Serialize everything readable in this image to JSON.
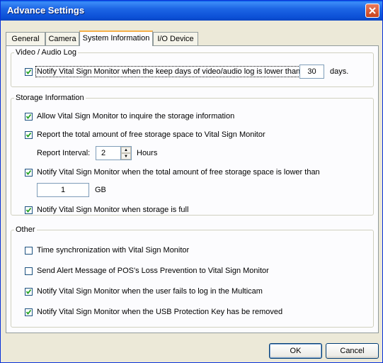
{
  "window": {
    "title": "Advance Settings"
  },
  "tabs": [
    "General",
    "Camera",
    "System Information",
    "I/O Device"
  ],
  "video_audio_log": {
    "legend": "Video / Audio Log",
    "notify_keep_days": {
      "label": "Notify Vital Sign Monitor when the keep days of video/audio log is lower than",
      "checked": true,
      "value": "30",
      "unit": "days."
    }
  },
  "storage": {
    "legend": "Storage Information",
    "allow_inquire": {
      "label": "Allow Vital Sign Monitor to inquire the storage information",
      "checked": true
    },
    "report_free": {
      "label": "Report the total amount of free storage space to Vital Sign Monitor",
      "checked": true
    },
    "report_interval": {
      "label": "Report Interval:",
      "value": "2",
      "unit": "Hours"
    },
    "notify_free_low": {
      "label": "Notify Vital Sign Monitor when the total amount of free storage space is lower than",
      "checked": true,
      "value": "1",
      "unit": "GB"
    },
    "notify_full": {
      "label": "Notify Vital Sign Monitor when storage is full",
      "checked": true
    }
  },
  "other": {
    "legend": "Other",
    "time_sync": {
      "label": "Time synchronization with Vital Sign Monitor",
      "checked": false
    },
    "pos_alert": {
      "label": "Send Alert Message of POS's Loss Prevention to Vital Sign Monitor",
      "checked": false
    },
    "login_fail": {
      "label": "Notify Vital Sign Monitor when the user fails to log in the Multicam",
      "checked": true
    },
    "usb_key": {
      "label": "Notify Vital Sign Monitor when the USB Protection Key has be removed",
      "checked": true
    }
  },
  "buttons": {
    "ok": "OK",
    "cancel": "Cancel"
  },
  "colors": {
    "titlebar": "#0b4fd6",
    "tab_highlight": "#f6b04a",
    "check": "#21a121"
  }
}
